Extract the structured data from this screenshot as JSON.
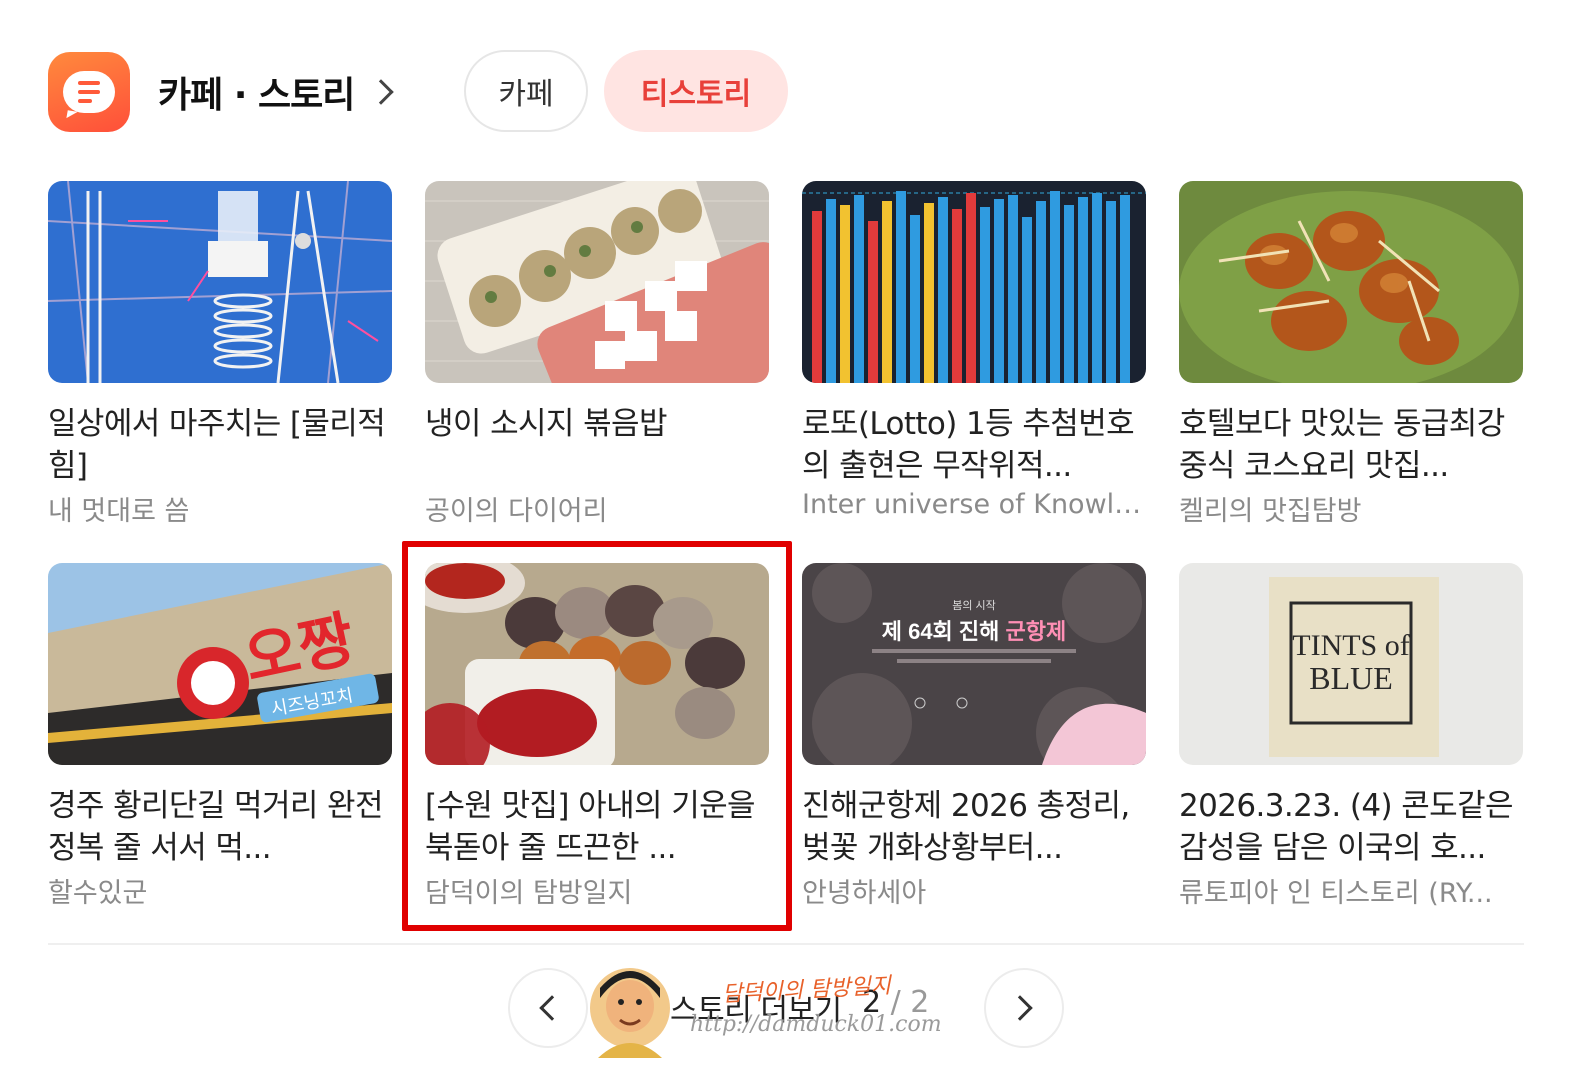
{
  "header": {
    "title": "카페 · 스토리",
    "tabs": [
      {
        "label": "카페",
        "selected": false
      },
      {
        "label": "티스토리",
        "selected": true
      }
    ]
  },
  "items": [
    {
      "title": "일상에서 마주치는 [물리적 힘]",
      "blog": "내 멋대로 씀",
      "thumb": "physics-drawing-image"
    },
    {
      "title": "냉이 소시지 볶음밥",
      "blog": "공이의 다이어리",
      "thumb": "lunchbox-image"
    },
    {
      "title": "로또(Lotto) 1등 추첨번호의 출현은 무작위적...",
      "blog": "Inter universe of Knowledg...",
      "thumb": "bar-graph-image"
    },
    {
      "title": "호텔보다 맛있는 동급최강 중식 코스요리 맛집...",
      "blog": "켈리의 맛집탐방",
      "thumb": "shrimp-dish-image"
    },
    {
      "title": "경주 황리단길 먹거리 완전 정복 줄 서서 먹...",
      "blog": "할수있군",
      "thumb": "shop-sign-image",
      "sign_text": "오짱",
      "sub_sign": "시즈닝꼬치"
    },
    {
      "title": "[수원 맛집] 아내의 기운을 북돋아 줄 뜨끈한 ...",
      "blog": "담덕이의 탐방일지",
      "thumb": "sundae-image"
    },
    {
      "title": "진해군항제 2026 총정리, 벚꽃 개화상황부터...",
      "blog": "안녕하세아",
      "thumb": "festival-poster-image",
      "poster_small": "봄의 시작",
      "poster_title": "제 64회 진해 ",
      "poster_highlight": "군항제"
    },
    {
      "title": "2026.3.23. (4) 콘도같은 감성을 담은 이국의 호...",
      "blog": "류토피아 인 티스토리 (RY...",
      "thumb": "fabric-label-image",
      "label_line1": "TINTS of",
      "label_line2": "BLUE"
    }
  ],
  "pager": {
    "more_label": "스토리 더보기",
    "current": "2",
    "separator": "/",
    "total": "2"
  },
  "watermark": {
    "name": "담덕이의 탐방일지",
    "url": "http://damduck01.com"
  },
  "colors": {
    "accent": "#e8403a",
    "highlight_border": "#e00000",
    "logo_gradient_start": "#ff8a3d",
    "logo_gradient_end": "#ff4f3a"
  }
}
